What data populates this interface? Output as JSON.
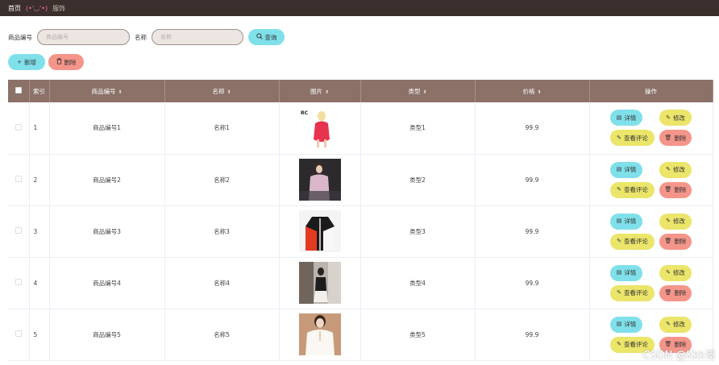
{
  "topbar": {
    "home": "首页",
    "face": "(•'◡'•)",
    "crumb": "服饰"
  },
  "search": {
    "code_label": "商品编号",
    "code_placeholder": "商品编号",
    "name_label": "名称",
    "name_placeholder": "名称",
    "query_label": "查询"
  },
  "actions": {
    "add_label": "新增",
    "delete_label": "删除"
  },
  "table": {
    "headers": [
      "索引",
      "商品编号",
      "名称",
      "图片",
      "类型",
      "价格",
      "操作"
    ],
    "rows": [
      {
        "index": "1",
        "code": "商品编号1",
        "name": "名称1",
        "type": "类型1",
        "price": "99.9",
        "image_alt": "RC"
      },
      {
        "index": "2",
        "code": "商品编号2",
        "name": "名称2",
        "type": "类型2",
        "price": "99.9"
      },
      {
        "index": "3",
        "code": "商品编号3",
        "name": "名称3",
        "type": "类型3",
        "price": "99.9"
      },
      {
        "index": "4",
        "code": "商品编号4",
        "name": "名称4",
        "type": "类型4",
        "price": "99.9"
      },
      {
        "index": "5",
        "code": "商品编号5",
        "name": "名称5",
        "type": "类型5",
        "price": "99.9"
      }
    ],
    "ops": {
      "detail": "详情",
      "edit": "修改",
      "review": "查看评论",
      "delete": "删除"
    }
  },
  "watermark": "CSDN @Kkk哥",
  "colors": {
    "topbar": "#3a2f2c",
    "header": "#8b7168",
    "cyan": "#7fe0ea",
    "yellow": "#ebe56a",
    "red": "#f5958a"
  }
}
